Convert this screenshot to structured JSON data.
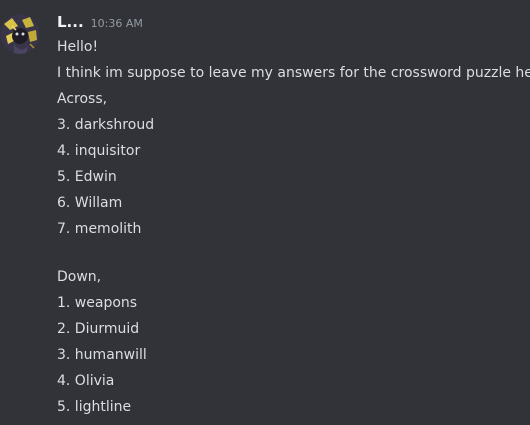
{
  "message": {
    "author": "L...",
    "timestamp": "10:36 AM",
    "lines": [
      "Hello!",
      "I think im suppose to leave my answers for the crossword puzzle here.",
      "Across,",
      "3. darkshroud",
      "4. inquisitor",
      "5. Edwin",
      "6. Willam",
      "7. memolith",
      "",
      "Down,",
      "1. weapons",
      "2. Diurmuid",
      "3. humanwill",
      "4. Olivia",
      "5. lightline"
    ]
  }
}
